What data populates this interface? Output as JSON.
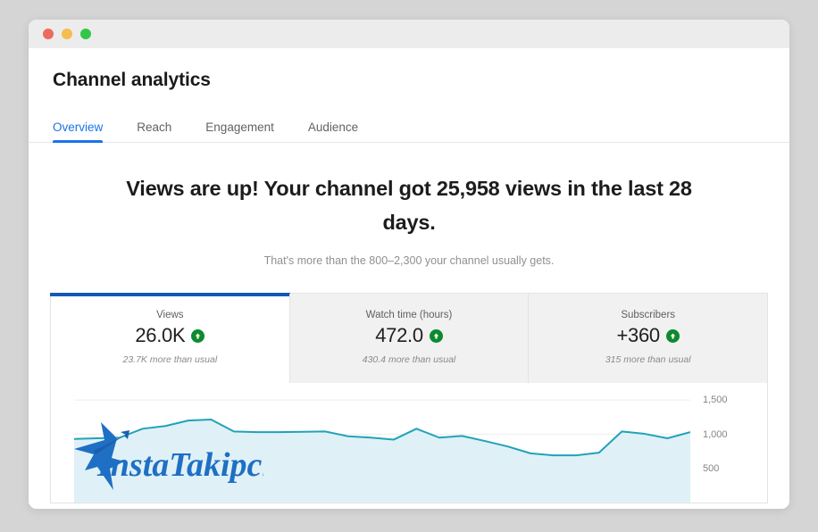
{
  "window": {
    "traffic_lights": [
      {
        "name": "close",
        "color": "#ec6a5e"
      },
      {
        "name": "minimize",
        "color": "#f5bd4f"
      },
      {
        "name": "maximize",
        "color": "#32c748"
      }
    ]
  },
  "page": {
    "title": "Channel analytics"
  },
  "tabs": [
    {
      "label": "Overview",
      "active": true
    },
    {
      "label": "Reach",
      "active": false
    },
    {
      "label": "Engagement",
      "active": false
    },
    {
      "label": "Audience",
      "active": false
    }
  ],
  "summary": {
    "headline": "Views are up! Your channel got 25,958 views in the last 28 days.",
    "subheadline": "That's more than the 800–2,300 your channel usually gets."
  },
  "metric_cards": [
    {
      "label": "Views",
      "value": "26.0K",
      "comparison": "23.7K more than usual",
      "trend": "up",
      "selected": true
    },
    {
      "label": "Watch time (hours)",
      "value": "472.0",
      "comparison": "430.4 more than usual",
      "trend": "up",
      "selected": false
    },
    {
      "label": "Subscribers",
      "value": "+360",
      "comparison": "315 more than usual",
      "trend": "up",
      "selected": false
    }
  ],
  "watermark": {
    "text": "InstaTakipci",
    "color": "#1f6fc4"
  },
  "colors": {
    "accent_blue": "#1a73e8",
    "card_selected_bar": "#1558b5",
    "trend_green": "#0d8a2e",
    "chart_line": "#21a2b8",
    "chart_fill": "#dff1f7",
    "page_background": "#d5d5d5"
  },
  "chart_data": {
    "type": "area",
    "title": "",
    "xlabel": "",
    "ylabel": "",
    "ylim": [
      0,
      1750
    ],
    "grid": true,
    "legend": "none",
    "y_ticks": [
      1500,
      1000,
      500
    ],
    "y_tick_labels": [
      "1,500",
      "1,000",
      "500"
    ],
    "x": [
      1,
      2,
      3,
      4,
      5,
      6,
      7,
      8,
      9,
      10,
      11,
      12,
      13,
      14,
      15,
      16,
      17,
      18,
      19,
      20,
      21,
      22,
      23,
      24,
      25,
      26,
      27,
      28
    ],
    "series": [
      {
        "name": "Views",
        "values": [
          930,
          940,
          950,
          1080,
          1120,
          1200,
          1215,
          1040,
          1030,
          1030,
          1035,
          1040,
          970,
          950,
          920,
          1080,
          950,
          975,
          900,
          820,
          720,
          690,
          690,
          730,
          1040,
          1005,
          940,
          1030
        ]
      }
    ]
  }
}
